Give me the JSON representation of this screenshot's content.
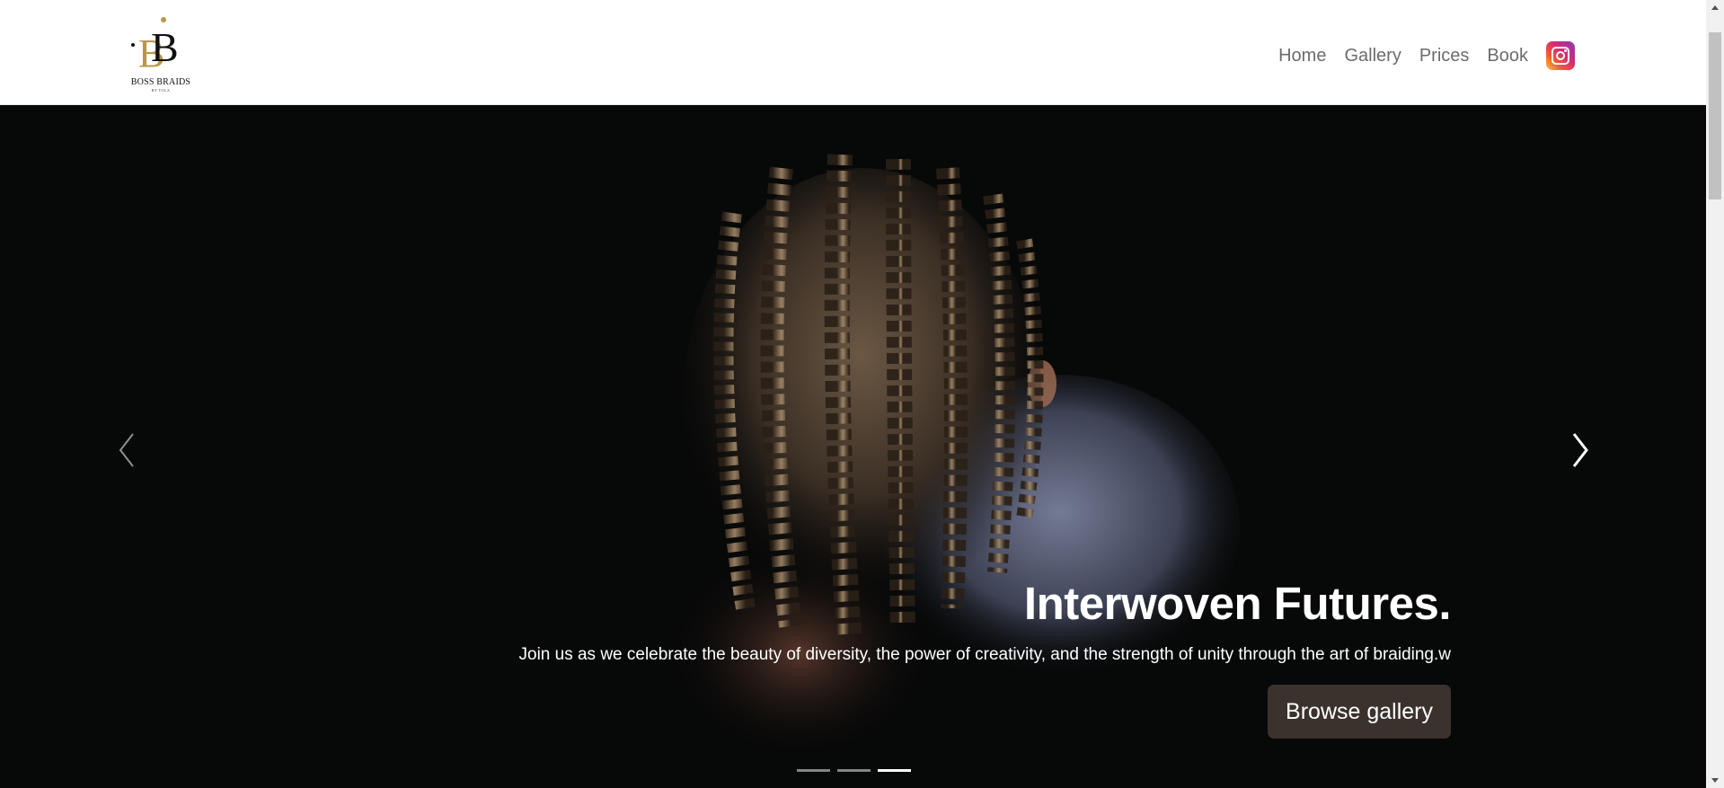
{
  "header": {
    "logo_text": "BOSS BRAIDS",
    "logo_subtext": "BY TOLA",
    "nav": [
      {
        "label": "Home"
      },
      {
        "label": "Gallery"
      },
      {
        "label": "Prices"
      },
      {
        "label": "Book"
      }
    ],
    "instagram_icon": "instagram-icon"
  },
  "hero": {
    "title": "Interwoven Futures.",
    "subtitle": "Join us as we celebrate the beauty of diversity, the power of creativity, and the strength of unity through the art of braiding.w",
    "cta_label": "Browse gallery",
    "prev_icon": "chevron-left-icon",
    "next_icon": "chevron-right-icon",
    "slide_count": 3,
    "active_slide": 3
  },
  "colors": {
    "hero_bg": "#070808",
    "cta_bg": "#3b322d",
    "nav_text": "#6c6c6c",
    "logo_gold": "#b8964a"
  }
}
